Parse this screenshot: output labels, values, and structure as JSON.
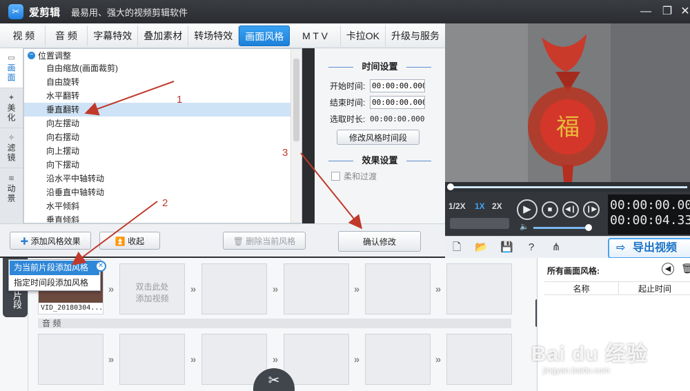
{
  "app": {
    "name": "爱剪辑",
    "slogan": "最易用、强大的视频剪辑软件"
  },
  "tabs": [
    "视 频",
    "音 频",
    "字幕特效",
    "叠加素材",
    "转场特效",
    "画面风格",
    "M T V",
    "卡拉OK",
    "升级与服务"
  ],
  "active_tab": "画面风格",
  "side_tabs": [
    {
      "label": "画面",
      "icon": "picture-icon"
    },
    {
      "label": "美化",
      "icon": "magic-wand-icon"
    },
    {
      "label": "滤镜",
      "icon": "filter-icon"
    },
    {
      "label": "动景",
      "icon": "wave-icon"
    }
  ],
  "style_list": {
    "group_label": "位置调整",
    "items": [
      "自由缩放(画面裁剪)",
      "自由旋转",
      "水平翻转",
      "垂直翻转",
      "向左摆动",
      "向右摆动",
      "向上摆动",
      "向下摆动",
      "沿水平中轴转动",
      "沿垂直中轴转动",
      "水平倾斜",
      "垂直倾斜"
    ],
    "selected": "垂直翻转"
  },
  "time_settings": {
    "title": "时间设置",
    "start_label": "开始时间:",
    "start_value": "00:00:00.000",
    "end_label": "结束时间:",
    "end_value": "00:00:00.000",
    "duration_label": "选取时长:",
    "duration_value": "00:00:00.000",
    "modify_button": "修改风格时间段"
  },
  "effect_settings": {
    "title": "效果设置",
    "soft_transition": "柔和过渡"
  },
  "toolbar": {
    "add_effect": "添加风格效果",
    "collapse": "收起",
    "delete_current": "删除当前风格",
    "confirm": "确认修改"
  },
  "popup": {
    "items": [
      "为当前片段添加风格",
      "指定时间段添加风格"
    ],
    "highlighted": "为当前片段添加风格"
  },
  "player": {
    "speeds": [
      "1/2X",
      "1X",
      "2X"
    ],
    "active_speed": "1X",
    "current_time": "00:00:00.000",
    "total_time": "00:00:04.331",
    "volume_level": 0.75
  },
  "actions": {
    "export": "导出视频",
    "icons": [
      "new-icon",
      "open-folder-icon",
      "save-icon",
      "help-icon",
      "share-icon"
    ]
  },
  "timeline": {
    "dock_label": "片段",
    "clip_filename": "VID_20180304...",
    "placeholder": "双击此处\n添加视频",
    "audio_label": "音 频"
  },
  "right_panel": {
    "title": "所有画面风格:",
    "col_name": "名称",
    "col_time": "起止时间"
  },
  "annotations": [
    "1",
    "2",
    "3"
  ],
  "watermark": {
    "brand": "Bai du 经验",
    "url": "jingyan.baidu.com"
  },
  "colors": {
    "accent": "#1d81d8",
    "selection": "#cfe3f7",
    "annotation": "#c0392b"
  }
}
